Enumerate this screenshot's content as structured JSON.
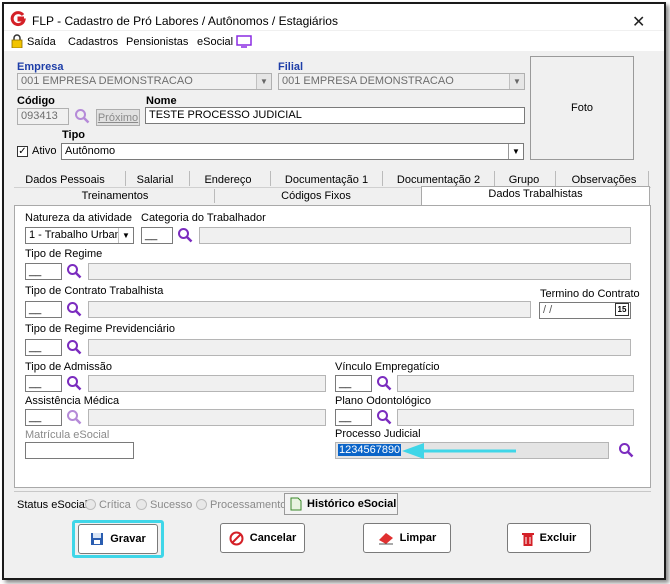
{
  "window": {
    "title": "FLP - Cadastro de Pró Labores / Autônomos / Estagiários",
    "close": "✕"
  },
  "menu": {
    "saida": "Saída",
    "cadastros": "Cadastros",
    "pensionistas": "Pensionistas",
    "esocial": "eSocial"
  },
  "header": {
    "empresa_label": "Empresa",
    "empresa_value": "001 EMPRESA DEMONSTRACAO",
    "filial_label": "Filial",
    "filial_value": "001 EMPRESA DEMONSTRACAO",
    "codigo_label": "Código",
    "codigo_value": "093413",
    "proximo_label": "Próximo",
    "nome_label": "Nome",
    "nome_value": "TESTE PROCESSO JUDICIAL",
    "ativo_label": "Ativo",
    "ativo_checked": true,
    "tipo_label": "Tipo",
    "tipo_value": "Autônomo",
    "foto_label": "Foto"
  },
  "tabs_row1": [
    "Dados Pessoais",
    "Salarial",
    "Endereço",
    "Documentação 1",
    "Documentação 2",
    "Grupo",
    "Observações"
  ],
  "tabs_row2": [
    "Treinamentos",
    "Códigos Fixos",
    "Dados Trabalhistas"
  ],
  "active_tab": "Dados Trabalhistas",
  "form": {
    "natureza_label": "Natureza da atividade",
    "natureza_value": "1 - Trabalho Urbano",
    "categoria_label": "Categoria do Trabalhador",
    "categoria_code": "__",
    "tipo_regime_label": "Tipo de Regime",
    "tipo_regime_code": "__",
    "tipo_contrato_label": "Tipo de Contrato Trabalhista",
    "tipo_contrato_code": "__",
    "termino_label": "Termino do Contrato",
    "termino_value": " / /",
    "calendar_label": "15",
    "regime_prev_label": "Tipo de Regime Previdenciário",
    "regime_prev_code": "__",
    "admissao_label": "Tipo de Admissão",
    "admissao_code": "__",
    "vinculo_label": "Vínculo Empregatício",
    "vinculo_code": "__",
    "assistencia_label": "Assistência Médica",
    "assistencia_code": "__",
    "plano_label": "Plano Odontológico",
    "plano_code": "__",
    "matricula_label": "Matrícula eSocial",
    "processo_label": "Processo Judicial",
    "processo_value": "1234567890"
  },
  "status": {
    "label": "Status eSocial:",
    "critica": "Crítica",
    "sucesso": "Sucesso",
    "processamento": "Processamento",
    "historico": "Histórico eSocial"
  },
  "buttons": {
    "gravar": "Gravar",
    "cancelar": "Cancelar",
    "limpar": "Limpar",
    "excluir": "Excluir"
  },
  "colors": {
    "accent_blue": "#1e3ea8",
    "search_purple": "#7b2cbf",
    "highlight_cyan": "#3fd6e8",
    "logo_red": "#d42027"
  }
}
